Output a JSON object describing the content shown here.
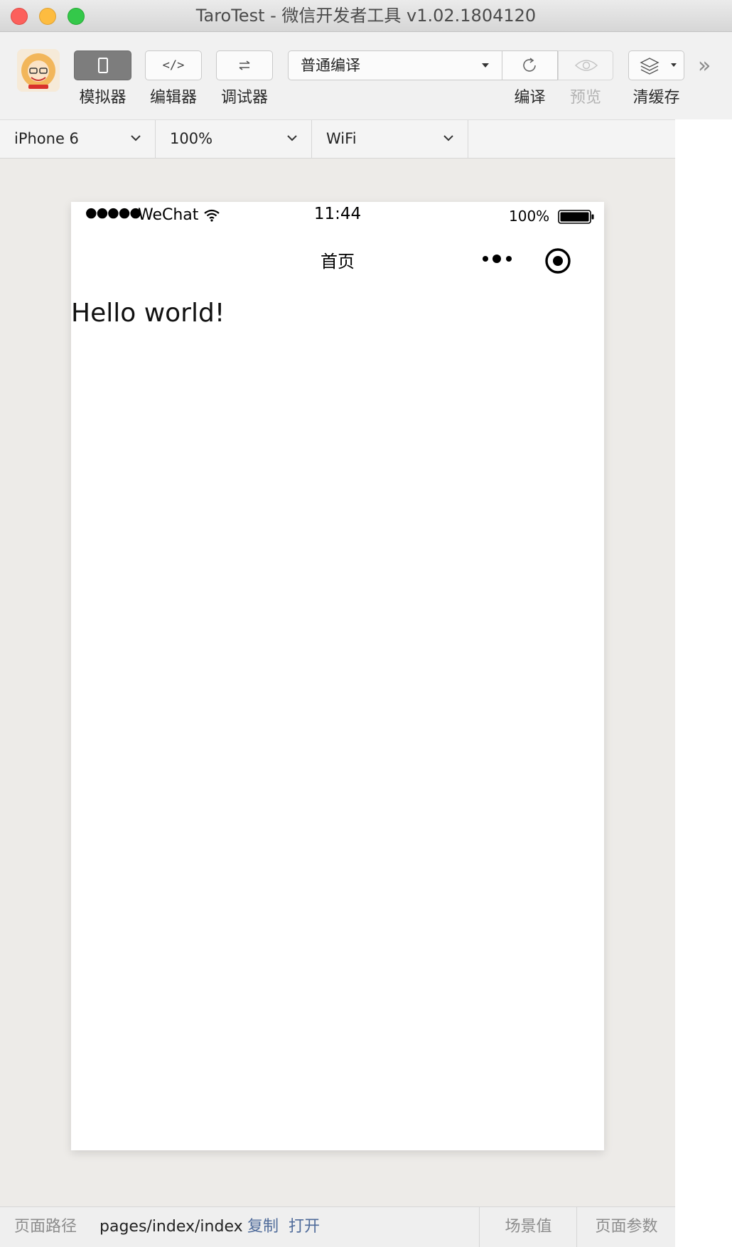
{
  "window": {
    "title": "TaroTest - 微信开发者工具 v1.02.1804120"
  },
  "toolbar": {
    "simulator_label": "模拟器",
    "editor_label": "编辑器",
    "debugger_label": "调试器",
    "compile_mode": "普通编译",
    "compile_label": "编译",
    "preview_label": "预览",
    "clear_cache_label": "清缓存",
    "more_glyph": "»",
    "editor_glyph": "</>",
    "simulator_active": true
  },
  "device_bar": {
    "device": "iPhone 6",
    "zoom": "100%",
    "network": "WiFi"
  },
  "phone": {
    "status": {
      "signal": "●●●●●",
      "carrier": "WeChat",
      "time": "11:44",
      "battery": "100%"
    },
    "nav": {
      "title": "首页"
    },
    "content": {
      "text": "Hello world!"
    }
  },
  "bottom_bar": {
    "path_label": "页面路径",
    "path_value": "pages/index/index",
    "copy_label": "复制",
    "open_label": "打开",
    "scene_label": "场景值",
    "params_label": "页面参数"
  },
  "colors": {
    "close": "#fc605c",
    "minimize": "#fdbc40",
    "maximize": "#34c84a",
    "link": "#4f6b9a",
    "simulator_bg": "#edebe8"
  }
}
